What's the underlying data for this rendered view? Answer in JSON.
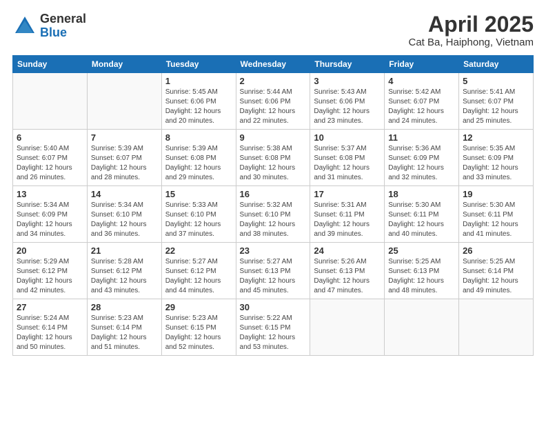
{
  "logo": {
    "general": "General",
    "blue": "Blue"
  },
  "header": {
    "month": "April 2025",
    "location": "Cat Ba, Haiphong, Vietnam"
  },
  "days_of_week": [
    "Sunday",
    "Monday",
    "Tuesday",
    "Wednesday",
    "Thursday",
    "Friday",
    "Saturday"
  ],
  "weeks": [
    [
      {
        "day": "",
        "info": ""
      },
      {
        "day": "",
        "info": ""
      },
      {
        "day": "1",
        "info": "Sunrise: 5:45 AM\nSunset: 6:06 PM\nDaylight: 12 hours and 20 minutes."
      },
      {
        "day": "2",
        "info": "Sunrise: 5:44 AM\nSunset: 6:06 PM\nDaylight: 12 hours and 22 minutes."
      },
      {
        "day": "3",
        "info": "Sunrise: 5:43 AM\nSunset: 6:06 PM\nDaylight: 12 hours and 23 minutes."
      },
      {
        "day": "4",
        "info": "Sunrise: 5:42 AM\nSunset: 6:07 PM\nDaylight: 12 hours and 24 minutes."
      },
      {
        "day": "5",
        "info": "Sunrise: 5:41 AM\nSunset: 6:07 PM\nDaylight: 12 hours and 25 minutes."
      }
    ],
    [
      {
        "day": "6",
        "info": "Sunrise: 5:40 AM\nSunset: 6:07 PM\nDaylight: 12 hours and 26 minutes."
      },
      {
        "day": "7",
        "info": "Sunrise: 5:39 AM\nSunset: 6:07 PM\nDaylight: 12 hours and 28 minutes."
      },
      {
        "day": "8",
        "info": "Sunrise: 5:39 AM\nSunset: 6:08 PM\nDaylight: 12 hours and 29 minutes."
      },
      {
        "day": "9",
        "info": "Sunrise: 5:38 AM\nSunset: 6:08 PM\nDaylight: 12 hours and 30 minutes."
      },
      {
        "day": "10",
        "info": "Sunrise: 5:37 AM\nSunset: 6:08 PM\nDaylight: 12 hours and 31 minutes."
      },
      {
        "day": "11",
        "info": "Sunrise: 5:36 AM\nSunset: 6:09 PM\nDaylight: 12 hours and 32 minutes."
      },
      {
        "day": "12",
        "info": "Sunrise: 5:35 AM\nSunset: 6:09 PM\nDaylight: 12 hours and 33 minutes."
      }
    ],
    [
      {
        "day": "13",
        "info": "Sunrise: 5:34 AM\nSunset: 6:09 PM\nDaylight: 12 hours and 34 minutes."
      },
      {
        "day": "14",
        "info": "Sunrise: 5:34 AM\nSunset: 6:10 PM\nDaylight: 12 hours and 36 minutes."
      },
      {
        "day": "15",
        "info": "Sunrise: 5:33 AM\nSunset: 6:10 PM\nDaylight: 12 hours and 37 minutes."
      },
      {
        "day": "16",
        "info": "Sunrise: 5:32 AM\nSunset: 6:10 PM\nDaylight: 12 hours and 38 minutes."
      },
      {
        "day": "17",
        "info": "Sunrise: 5:31 AM\nSunset: 6:11 PM\nDaylight: 12 hours and 39 minutes."
      },
      {
        "day": "18",
        "info": "Sunrise: 5:30 AM\nSunset: 6:11 PM\nDaylight: 12 hours and 40 minutes."
      },
      {
        "day": "19",
        "info": "Sunrise: 5:30 AM\nSunset: 6:11 PM\nDaylight: 12 hours and 41 minutes."
      }
    ],
    [
      {
        "day": "20",
        "info": "Sunrise: 5:29 AM\nSunset: 6:12 PM\nDaylight: 12 hours and 42 minutes."
      },
      {
        "day": "21",
        "info": "Sunrise: 5:28 AM\nSunset: 6:12 PM\nDaylight: 12 hours and 43 minutes."
      },
      {
        "day": "22",
        "info": "Sunrise: 5:27 AM\nSunset: 6:12 PM\nDaylight: 12 hours and 44 minutes."
      },
      {
        "day": "23",
        "info": "Sunrise: 5:27 AM\nSunset: 6:13 PM\nDaylight: 12 hours and 45 minutes."
      },
      {
        "day": "24",
        "info": "Sunrise: 5:26 AM\nSunset: 6:13 PM\nDaylight: 12 hours and 47 minutes."
      },
      {
        "day": "25",
        "info": "Sunrise: 5:25 AM\nSunset: 6:13 PM\nDaylight: 12 hours and 48 minutes."
      },
      {
        "day": "26",
        "info": "Sunrise: 5:25 AM\nSunset: 6:14 PM\nDaylight: 12 hours and 49 minutes."
      }
    ],
    [
      {
        "day": "27",
        "info": "Sunrise: 5:24 AM\nSunset: 6:14 PM\nDaylight: 12 hours and 50 minutes."
      },
      {
        "day": "28",
        "info": "Sunrise: 5:23 AM\nSunset: 6:14 PM\nDaylight: 12 hours and 51 minutes."
      },
      {
        "day": "29",
        "info": "Sunrise: 5:23 AM\nSunset: 6:15 PM\nDaylight: 12 hours and 52 minutes."
      },
      {
        "day": "30",
        "info": "Sunrise: 5:22 AM\nSunset: 6:15 PM\nDaylight: 12 hours and 53 minutes."
      },
      {
        "day": "",
        "info": ""
      },
      {
        "day": "",
        "info": ""
      },
      {
        "day": "",
        "info": ""
      }
    ]
  ]
}
